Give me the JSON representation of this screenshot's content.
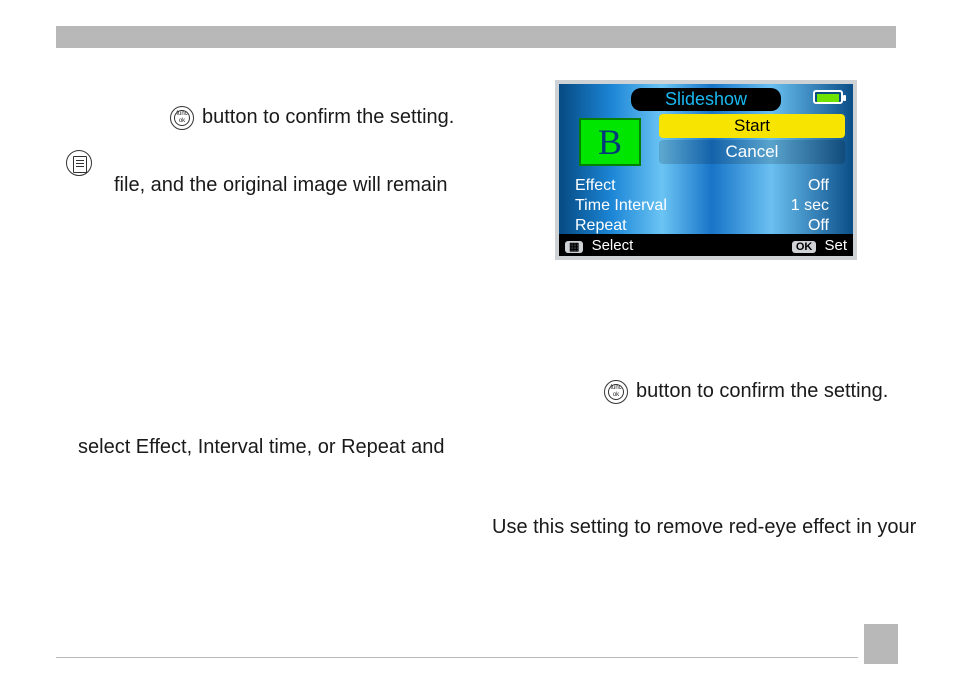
{
  "frag1": "button to confirm the setting.",
  "frag2": "file, and the original image will remain",
  "frag3": "button to confirm the setting.",
  "frag4": "select Effect, Interval time, or Repeat and",
  "frag5": "Use this setting to remove red-eye effect in your",
  "func": {
    "top": "func",
    "bottom": "ok"
  },
  "cam": {
    "title": "Slideshow",
    "b": "B",
    "start": "Start",
    "cancel": "Cancel",
    "rows": [
      {
        "label": "Effect",
        "value": "Off"
      },
      {
        "label": "Time Interval",
        "value": "1 sec"
      },
      {
        "label": "Repeat",
        "value": "Off"
      }
    ],
    "footer": {
      "leftIcon": "▦",
      "leftText": "Select",
      "rightIcon": "OK",
      "rightText": "Set"
    }
  }
}
